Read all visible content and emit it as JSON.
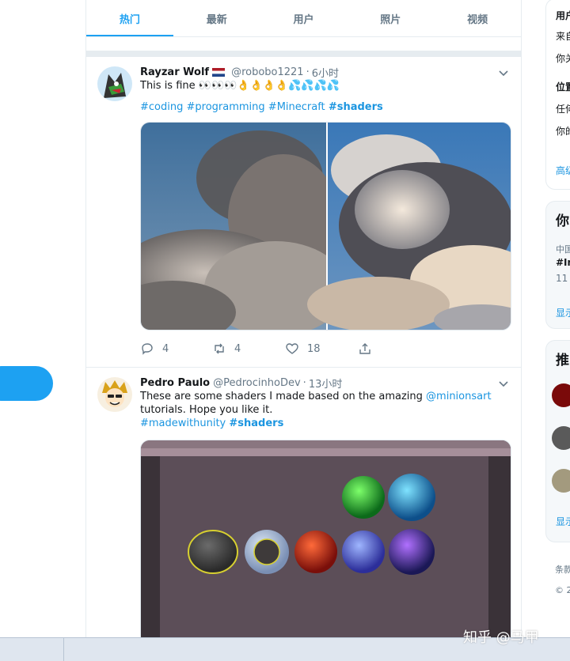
{
  "tabs": [
    {
      "label": "热门",
      "active": true
    },
    {
      "label": "最新",
      "active": false
    },
    {
      "label": "用户",
      "active": false
    },
    {
      "label": "照片",
      "active": false
    },
    {
      "label": "视频",
      "active": false
    }
  ],
  "tweets": [
    {
      "name": "Rayzar Wolf",
      "flag": "netherlands-flag",
      "handle": "@robobo1221",
      "time": "6小时",
      "text": "This is fine 👀👀👀👌👌👌👌💦💦💦💦",
      "tags": [
        "#coding",
        "#programming",
        "#Minecraft"
      ],
      "tag_bold": "#shaders",
      "media": "cloud-shader-comparison",
      "replies": "4",
      "retweets": "4",
      "likes": "18"
    },
    {
      "name": "Pedro Paulo",
      "handle": "@PedrocinhoDev",
      "time": "13小时",
      "text_start": "These are some shaders I made based on the amazing",
      "mention": "@minionsart",
      "text_end": "tutorials. Hope you like it.",
      "tag_plain": "#madewithunity",
      "tag_bold": "#shaders",
      "media": "unity-shader-spheres"
    }
  ],
  "sidebar": {
    "card1": [
      "用户",
      "来自",
      "你关",
      "位置",
      "任何",
      "你的",
      "高级"
    ],
    "card2": [
      "你",
      "中国",
      "#In",
      "11",
      "显示"
    ],
    "card3": [
      "推",
      "显示"
    ],
    "footer": [
      "条款",
      "© 2"
    ]
  },
  "watermark": "知乎 @马甲",
  "colors": {
    "accent": "#1da1f2",
    "link": "#1b95e0",
    "muted": "#657786"
  }
}
